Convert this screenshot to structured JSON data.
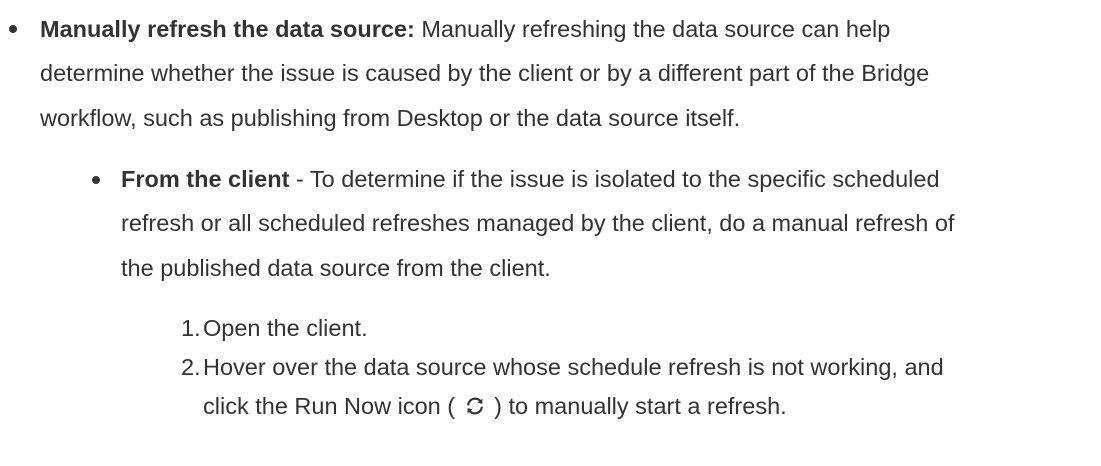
{
  "item1": {
    "term": "Manually refresh the data source:",
    "line1_rest": " Manually refreshing the data source can help",
    "line2": "determine whether the issue is caused by the client or by a different part of the Bridge",
    "line3": "workflow, such as publishing from Desktop or the data source itself."
  },
  "subitem1": {
    "term": "From the client",
    "line1_rest": " - To determine if the issue is isolated to the specific scheduled",
    "line2": "refresh or all scheduled refreshes managed by the client, do a manual refresh of",
    "line3": "the published data source from the client."
  },
  "steps": [
    {
      "number": "1.",
      "line1": "Open the client."
    },
    {
      "number": "2.",
      "line1": "Hover over the data source whose schedule refresh is not working, and",
      "line2_before_icon": "click the Run Now icon ( ",
      "line2_after_icon": " ) to manually start a refresh."
    }
  ],
  "icons": {
    "run_now": "refresh-icon"
  }
}
